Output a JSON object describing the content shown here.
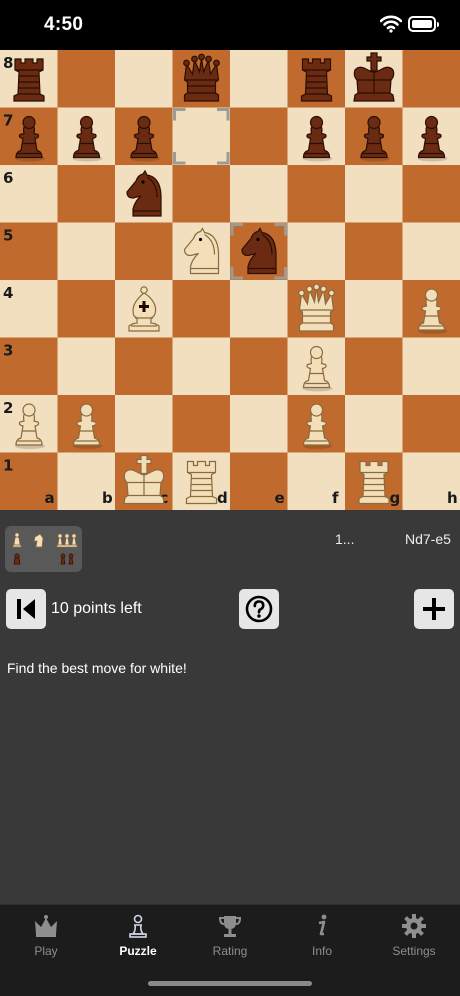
{
  "status_bar": {
    "time": "4:50"
  },
  "board": {
    "files": [
      "a",
      "b",
      "c",
      "d",
      "e",
      "f",
      "g",
      "h"
    ],
    "ranks": [
      "8",
      "7",
      "6",
      "5",
      "4",
      "3",
      "2",
      "1"
    ],
    "pieces": [
      {
        "sq": "a8",
        "type": "rook",
        "color": "black"
      },
      {
        "sq": "d8",
        "type": "queen",
        "color": "black"
      },
      {
        "sq": "f8",
        "type": "rook",
        "color": "black"
      },
      {
        "sq": "g8",
        "type": "king",
        "color": "black"
      },
      {
        "sq": "a7",
        "type": "pawn",
        "color": "black"
      },
      {
        "sq": "b7",
        "type": "pawn",
        "color": "black"
      },
      {
        "sq": "c7",
        "type": "pawn",
        "color": "black"
      },
      {
        "sq": "f7",
        "type": "pawn",
        "color": "black"
      },
      {
        "sq": "g7",
        "type": "pawn",
        "color": "black"
      },
      {
        "sq": "h7",
        "type": "pawn",
        "color": "black"
      },
      {
        "sq": "c6",
        "type": "knight",
        "color": "black"
      },
      {
        "sq": "e5",
        "type": "knight",
        "color": "black"
      },
      {
        "sq": "d5",
        "type": "knight",
        "color": "white"
      },
      {
        "sq": "c4",
        "type": "bishop",
        "color": "white"
      },
      {
        "sq": "f4",
        "type": "queen",
        "color": "white"
      },
      {
        "sq": "h4",
        "type": "pawn",
        "color": "white"
      },
      {
        "sq": "f3",
        "type": "pawn",
        "color": "white"
      },
      {
        "sq": "a2",
        "type": "pawn",
        "color": "white"
      },
      {
        "sq": "b2",
        "type": "pawn",
        "color": "white"
      },
      {
        "sq": "f2",
        "type": "pawn",
        "color": "white"
      },
      {
        "sq": "c1",
        "type": "king",
        "color": "white"
      },
      {
        "sq": "d1",
        "type": "rook",
        "color": "white"
      },
      {
        "sq": "g1",
        "type": "rook",
        "color": "white"
      }
    ],
    "last_move_from": "d7",
    "last_move_to": "e5"
  },
  "material": {
    "top": [
      "bishop",
      "knight",
      "pawn-pair"
    ],
    "bottom": [
      "pawn",
      "pawn-pair"
    ]
  },
  "move_list": {
    "number": "1...",
    "move": "Nd7-e5"
  },
  "controls": {
    "first_icon": "skip-to-start-icon",
    "points_left": "10 points left",
    "hint_icon": "question-circle-icon",
    "add_icon": "plus-icon"
  },
  "task": "Find the best move for white!",
  "tabs": [
    {
      "label": "Play",
      "icon": "crown-icon",
      "active": false
    },
    {
      "label": "Puzzle",
      "icon": "pawn-icon",
      "active": true
    },
    {
      "label": "Rating",
      "icon": "trophy-icon",
      "active": false
    },
    {
      "label": "Info",
      "icon": "info-icon",
      "active": false
    },
    {
      "label": "Settings",
      "icon": "gear-icon",
      "active": false
    }
  ]
}
